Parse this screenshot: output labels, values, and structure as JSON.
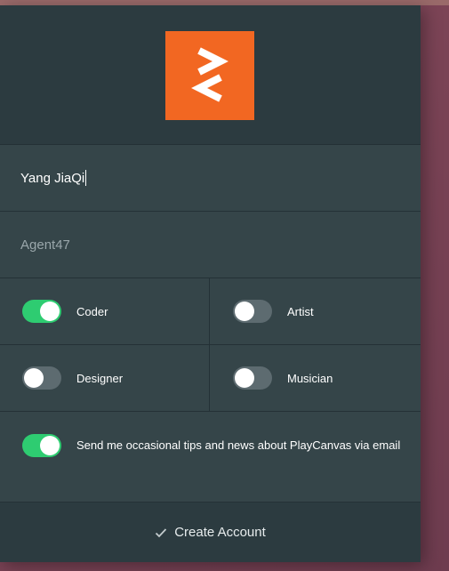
{
  "form": {
    "logo_icon": "playcanvas-logo-icon",
    "accent_color": "#f26722",
    "name_value": "Yang JiaQi",
    "username_placeholder": "Agent47",
    "roles": [
      {
        "label": "Coder",
        "on": true
      },
      {
        "label": "Artist",
        "on": false
      },
      {
        "label": "Designer",
        "on": false
      },
      {
        "label": "Musician",
        "on": false
      }
    ],
    "newsletter": {
      "label": "Send me occasional tips and news about PlayCanvas via email",
      "on": true
    },
    "create_label": "Create Account",
    "create_icon": "checkmark-icon",
    "toggle_on_color": "#2ecc71"
  }
}
